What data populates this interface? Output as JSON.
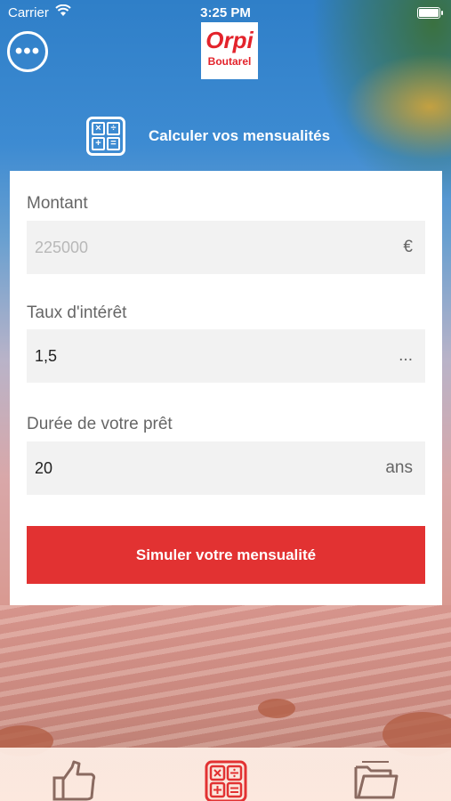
{
  "status_bar": {
    "carrier": "Carrier",
    "time": "3:25 PM"
  },
  "header": {
    "menu_glyph": "•••",
    "logo_brand": "Orpi",
    "logo_agency": "Boutarel",
    "title": "Calculer vos mensualités",
    "title_icon": "calculator-icon"
  },
  "form": {
    "amount": {
      "label": "Montant",
      "placeholder": "225000",
      "unit": "€"
    },
    "rate": {
      "label": "Taux d'intérêt",
      "value": "1,5",
      "unit": "..."
    },
    "duration": {
      "label": "Durée de votre prêt",
      "value": "20",
      "unit": "ans"
    },
    "submit_label": "Simuler votre mensualité"
  },
  "tabbar": {
    "items": [
      {
        "icon": "thumbs-up-icon",
        "active": false
      },
      {
        "icon": "calculator-icon",
        "active": true
      },
      {
        "icon": "folder-icon",
        "active": false
      }
    ]
  },
  "colors": {
    "accent": "#e23232",
    "brand": "#e3232b"
  }
}
